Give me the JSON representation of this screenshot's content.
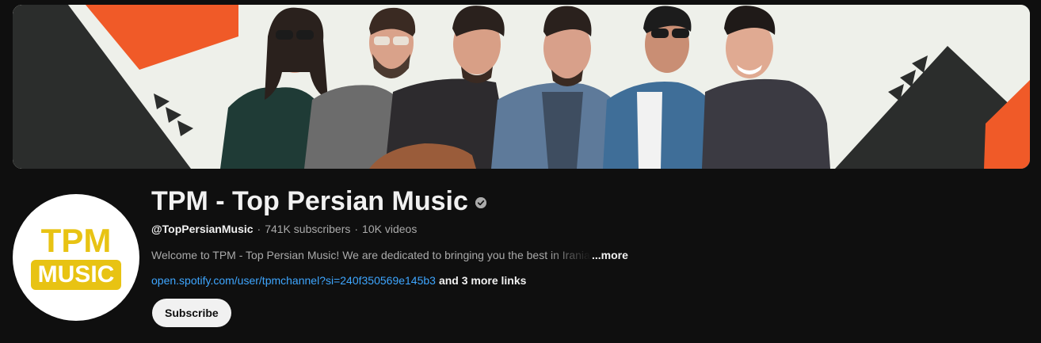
{
  "banner": {
    "name": "channel-banner",
    "colors": {
      "background": "#eef0ea",
      "accent_orange": "#f05a28",
      "dark": "#2b2d2c"
    }
  },
  "avatar": {
    "logo_top": "TPM",
    "logo_bottom": "MUSIC",
    "colors": {
      "gold": "#e8c313",
      "background": "#ffffff"
    }
  },
  "channel": {
    "title": "TPM - Top Persian Music",
    "verified_icon": "verified-check-icon",
    "handle": "@TopPersianMusic",
    "subscribers": "741K subscribers",
    "videos": "10K videos",
    "separator": "·",
    "description": "Welcome to TPM - Top Persian Music! We are dedicated to bringing you the best in Iranian",
    "description_more": "...more",
    "link": "open.spotify.com/user/tpmchannel?si=240f350569e145b3",
    "more_links": "and 3 more links"
  },
  "actions": {
    "subscribe_label": "Subscribe"
  },
  "colors": {
    "page_background": "#0f0f0f",
    "text_primary": "#f1f1f1",
    "text_secondary": "#aaaaaa",
    "link": "#3ea6ff"
  }
}
